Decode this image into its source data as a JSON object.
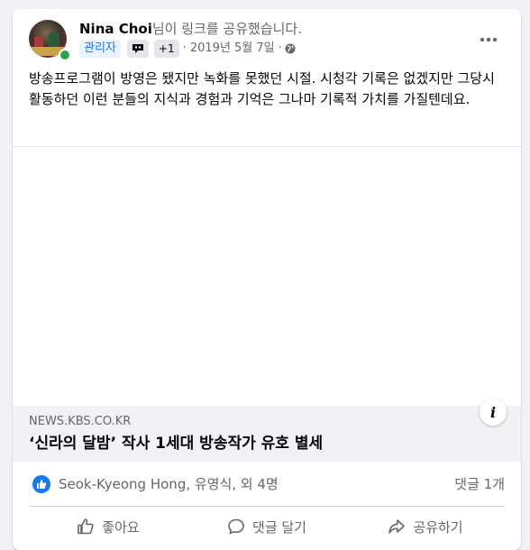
{
  "post": {
    "author": "Nina Choi",
    "action_text": "님이 링크를 공유했습니다.",
    "admin_badge": "관리자",
    "plus_badge": "+1",
    "timestamp": "· 2019년 5월 7일 ·",
    "body": "방송프로그램이 방영은 됐지만 녹화를 못했던 시절. 시청각 기록은 없겠지만 그당시 활동하던 이런 분들의 지식과 경험과 기억은 그나마 기록적 가치를 가질텐데요."
  },
  "link": {
    "domain": "NEWS.KBS.CO.KR",
    "title": "‘신라의 달밤’ 작사 1세대 방송작가 유호 별세"
  },
  "reactions": {
    "names": "Seok-Kyeong Hong, 유영식, 외 4명",
    "comments": "댓글 1개"
  },
  "actions": {
    "like": "좋아요",
    "comment": "댓글 달기",
    "share": "공유하기"
  },
  "colors": {
    "accent": "#1877f2",
    "online": "#31a24c",
    "secondary_text": "#65676b"
  },
  "icons": [
    "more-icon",
    "globe-icon",
    "badge-icon",
    "like-reaction-icon",
    "like-icon",
    "comment-icon",
    "share-icon",
    "info-icon"
  ]
}
